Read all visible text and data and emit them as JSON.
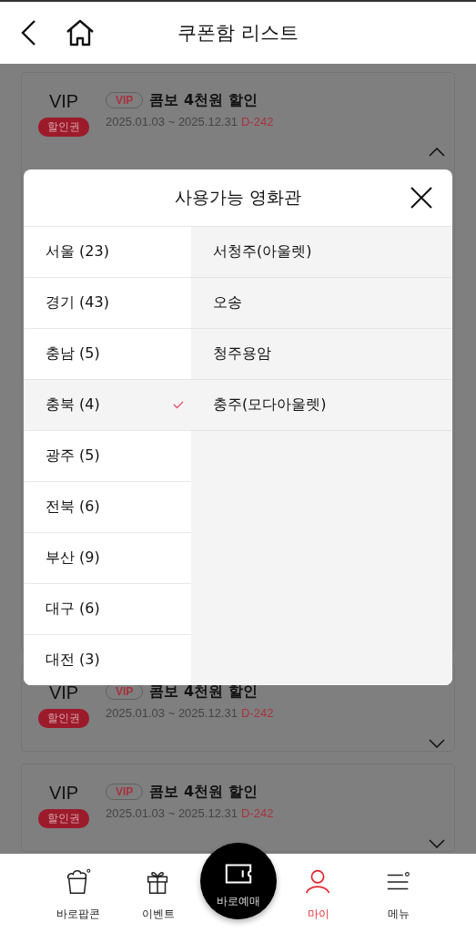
{
  "header": {
    "title": "쿠폰함 리스트"
  },
  "coupons": [
    {
      "grade": "VIP",
      "badge": "할인권",
      "chip": "VIP",
      "title": "콤보 4천원 할인",
      "period": "2025.01.03 ~ 2025.12.31",
      "dday": "D-242",
      "expanded": true
    },
    {
      "grade": "VIP",
      "badge": "할인권",
      "chip": "VIP",
      "title": "콤보 4천원 할인",
      "period": "2025.01.03 ~ 2025.12.31",
      "dday": "D-242",
      "expanded": false
    },
    {
      "grade": "VIP",
      "badge": "할인권",
      "chip": "VIP",
      "title": "콤보 4천원 할인",
      "period": "2025.01.03 ~ 2025.12.31",
      "dday": "D-242",
      "expanded": false
    }
  ],
  "modal": {
    "title": "사용가능 영화관",
    "regions": [
      {
        "label": "서울 (23)",
        "selected": false
      },
      {
        "label": "경기 (43)",
        "selected": false
      },
      {
        "label": "충남 (5)",
        "selected": false
      },
      {
        "label": "충북 (4)",
        "selected": true
      },
      {
        "label": "광주 (5)",
        "selected": false
      },
      {
        "label": "전북 (6)",
        "selected": false
      },
      {
        "label": "부산 (9)",
        "selected": false
      },
      {
        "label": "대구 (6)",
        "selected": false
      },
      {
        "label": "대전 (3)",
        "selected": false
      }
    ],
    "theaters": [
      "서청주(아울렛)",
      "오송",
      "청주용암",
      "충주(모다아울렛)"
    ]
  },
  "nav": [
    {
      "label": "바로팝콘",
      "kind": "tab",
      "selected": false
    },
    {
      "label": "이벤트",
      "kind": "tab",
      "selected": false
    },
    {
      "label": "바로예매",
      "kind": "primary",
      "selected": false
    },
    {
      "label": "마이",
      "kind": "tab",
      "selected": true
    },
    {
      "label": "메뉴",
      "kind": "tab",
      "selected": false
    }
  ]
}
